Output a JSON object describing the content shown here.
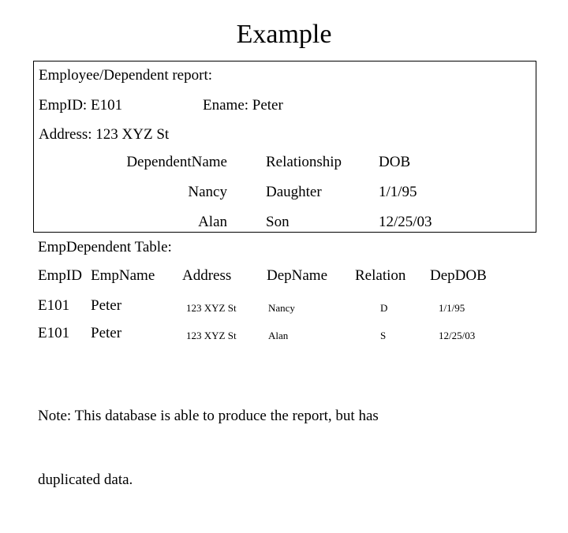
{
  "slide": {
    "title": "Example",
    "background_color": "#ffffff",
    "text_color": "#000000"
  },
  "report_box": {
    "border_color": "#000000",
    "heading": "Employee/Dependent report:",
    "emp_id_label": "EmpID: E101",
    "ename_label": "Ename: Peter",
    "address_label": "Address: 123 XYZ St",
    "columns": [
      "DependentName",
      "Relationship",
      "DOB"
    ],
    "rows": [
      {
        "name": "Nancy",
        "relationship": "Daughter",
        "dob": "1/1/95"
      },
      {
        "name": "Alan",
        "relationship": "Son",
        "dob": "12/25/03"
      }
    ]
  },
  "emp_dependent_table": {
    "caption": "EmpDependent Table:",
    "columns": [
      "EmpID",
      "EmpName",
      "Address",
      "DepName",
      "Relation",
      "DepDOB"
    ],
    "rows": [
      {
        "emp_id": "E101",
        "emp_name": "Peter",
        "address": "123 XYZ St",
        "dep_name": "Nancy",
        "relation": "D",
        "dep_dob": "1/1/95"
      },
      {
        "emp_id": "E101",
        "emp_name": "Peter",
        "address": "123 XYZ St",
        "dep_name": "Alan",
        "relation": "S",
        "dep_dob": "12/25/03"
      }
    ]
  },
  "note": {
    "line1": "Note: This database is able to produce the report, but has",
    "line2": "duplicated data."
  }
}
